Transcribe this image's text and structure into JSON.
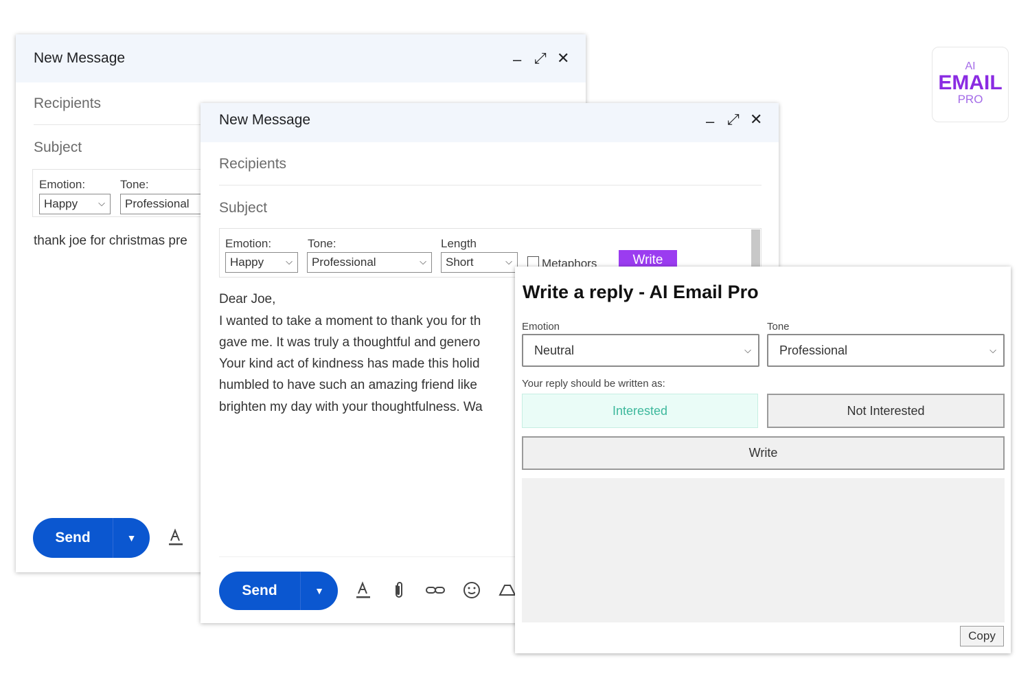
{
  "compose_back": {
    "title": "New Message",
    "recipients_placeholder": "Recipients",
    "subject_placeholder": "Subject",
    "toolbar": {
      "emotion_label": "Emotion:",
      "emotion_value": "Happy",
      "tone_label": "Tone:",
      "tone_value": "Professional"
    },
    "body_text": "thank joe for christmas pre",
    "send_label": "Send"
  },
  "compose_front": {
    "title": "New Message",
    "recipients_placeholder": "Recipients",
    "subject_placeholder": "Subject",
    "toolbar": {
      "emotion_label": "Emotion:",
      "emotion_value": "Happy",
      "tone_label": "Tone:",
      "tone_value": "Professional",
      "length_label": "Length",
      "length_value": "Short",
      "metaphors_label": "Metaphors",
      "write_label": "Write"
    },
    "body_lines": [
      "Dear Joe,",
      "I wanted to take a moment to thank you for th",
      "gave me. It was truly a thoughtful and genero",
      "Your kind act of kindness has made this holid",
      "humbled to have such an amazing friend like",
      "brighten my day with your thoughtfulness. Wa"
    ],
    "send_label": "Send"
  },
  "ai_panel": {
    "title": "Write a reply - AI Email Pro",
    "emotion_label": "Emotion",
    "emotion_value": "Neutral",
    "tone_label": "Tone",
    "tone_value": "Professional",
    "reply_as_label": "Your reply should be written as:",
    "interested_label": "Interested",
    "not_interested_label": "Not Interested",
    "write_label": "Write",
    "copy_label": "Copy",
    "output_text": ""
  },
  "logo": {
    "line1": "AI",
    "line2": "EMAIL",
    "line3": "PRO"
  },
  "colors": {
    "send_blue": "#0b57d0",
    "header_bg": "#f2f6fc",
    "write_purple": "#9b3cf0",
    "logo_purple": "#8a2be2",
    "interested_bg": "#eafcf7",
    "interested_text": "#3db89c"
  }
}
